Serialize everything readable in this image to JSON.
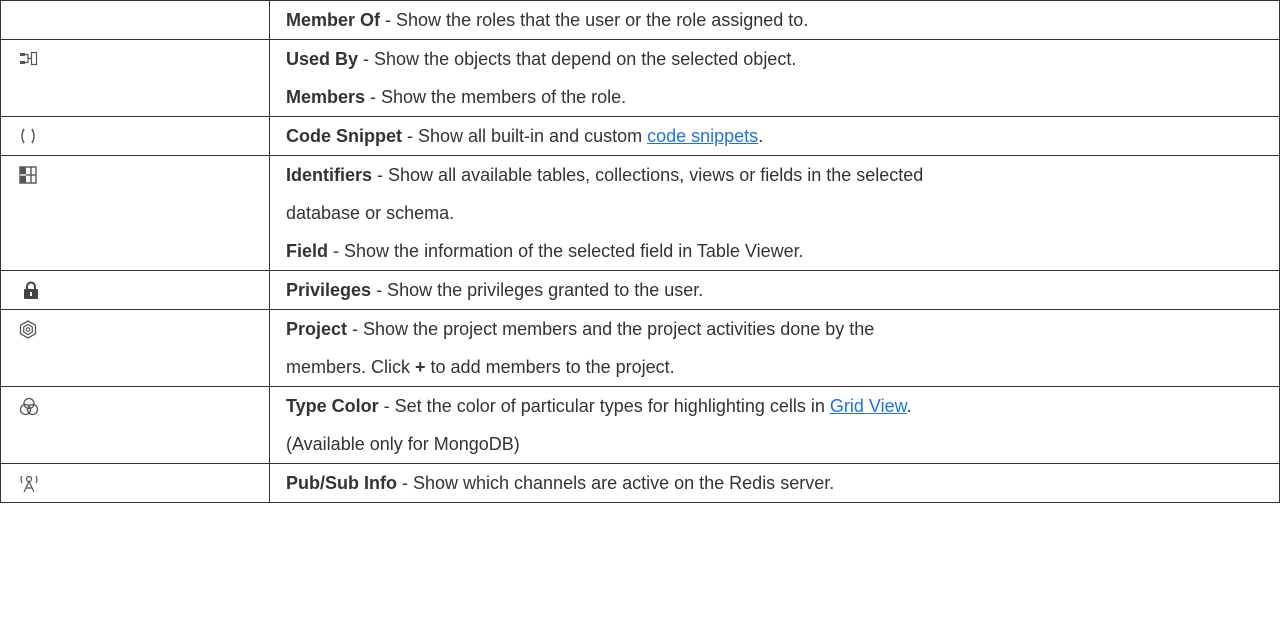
{
  "rows": [
    {
      "icon": "",
      "lines": [
        {
          "title": "Member Of",
          "text": " - Show the roles that the user or the role assigned to."
        }
      ]
    },
    {
      "icon": "used-by-icon",
      "lines": [
        {
          "title": "Used By",
          "text": " - Show the objects that depend on the selected object."
        },
        {
          "title": "Members",
          "text": " - Show the members of the role."
        }
      ]
    },
    {
      "icon": "code-snippet-icon",
      "lines": [
        {
          "title": "Code Snippet",
          "text": " - Show all built-in and custom ",
          "link": "code snippets",
          "after": "."
        }
      ]
    },
    {
      "icon": "identifiers-icon",
      "lines": [
        {
          "title": "Identifiers",
          "text": " - Show all available tables, collections, views or fields in the selected"
        },
        {
          "text": "database or schema."
        },
        {
          "title": "Field",
          "text": " - Show the information of the selected field in Table Viewer."
        }
      ]
    },
    {
      "icon": "lock-icon",
      "lines": [
        {
          "title": "Privileges",
          "text": " - Show the privileges granted to the user."
        }
      ]
    },
    {
      "icon": "project-icon",
      "lines": [
        {
          "title": "Project",
          "text": " - Show the project members and the project activities done by the"
        },
        {
          "text": "members. Click ",
          "bold": "+",
          "after": " to add members to the project."
        }
      ]
    },
    {
      "icon": "type-color-icon",
      "lines": [
        {
          "title": "Type Color",
          "text": " - Set the color of particular types for highlighting cells in ",
          "link": "Grid View",
          "after": "."
        },
        {
          "text": "(Available only for MongoDB)"
        }
      ]
    },
    {
      "icon": "antenna-icon",
      "lines": [
        {
          "title": "Pub/Sub Info",
          "text": " - Show which channels are active on the Redis server."
        }
      ]
    }
  ]
}
